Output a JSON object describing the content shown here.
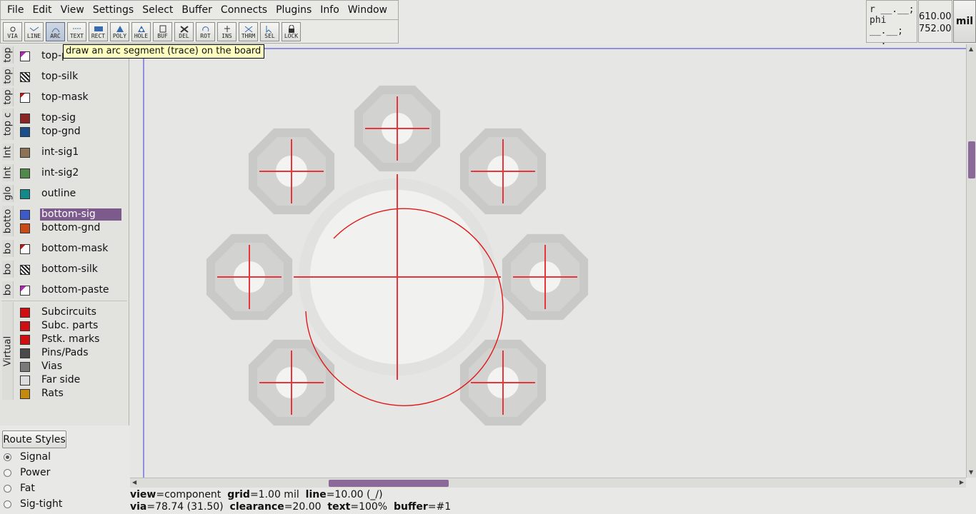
{
  "menu": [
    "File",
    "Edit",
    "View",
    "Settings",
    "Select",
    "Buffer",
    "Connects",
    "Plugins",
    "Info",
    "Window"
  ],
  "toolbar": [
    {
      "label": "VIA",
      "icon": "via-icon"
    },
    {
      "label": "LINE",
      "icon": "line-icon"
    },
    {
      "label": "ARC",
      "icon": "arc-icon",
      "active": true
    },
    {
      "label": "TEXT",
      "icon": "text-icon"
    },
    {
      "label": "RECT",
      "icon": "rect-icon"
    },
    {
      "label": "POLY",
      "icon": "poly-icon"
    },
    {
      "label": "HOLE",
      "icon": "hole-icon"
    },
    {
      "label": "BUF",
      "icon": "buffer-icon"
    },
    {
      "label": "DEL",
      "icon": "delete-icon"
    },
    {
      "label": "ROT",
      "icon": "rotate-icon"
    },
    {
      "label": "INS",
      "icon": "insert-icon"
    },
    {
      "label": "THRM",
      "icon": "thermal-icon"
    },
    {
      "label": "SEL",
      "icon": "select-icon"
    },
    {
      "label": "LOCK",
      "icon": "lock-icon"
    }
  ],
  "tooltip": "draw an arc segment (trace) on the board",
  "coords": {
    "r_label": "r __.__;",
    "phi_label": "phi __.__;",
    "blank": "__.__ __.__",
    "x": "610.00",
    "y": "752.00",
    "unit": "mil"
  },
  "layer_groups": [
    "top",
    "top",
    "top",
    "top c",
    "Int",
    "Int",
    "glo",
    "botto",
    "bo",
    "bo",
    "bo",
    "Virtual"
  ],
  "layers": [
    {
      "name": "top-paste",
      "color": "#ffffff"
    },
    {
      "name": "top-silk",
      "color": "#222222"
    },
    {
      "name": "top-mask",
      "color": "#ffffff"
    },
    {
      "name": "top-sig",
      "color": "#8b2525"
    },
    {
      "name": "top-gnd",
      "color": "#1a4f8c"
    },
    {
      "name": "int-sig1",
      "color": "#8c7355"
    },
    {
      "name": "int-sig2",
      "color": "#4f8a4a"
    },
    {
      "name": "outline",
      "color": "#138a8a"
    },
    {
      "name": "bottom-sig",
      "color": "#3e59c9",
      "selected": true
    },
    {
      "name": "bottom-gnd",
      "color": "#c94a14"
    },
    {
      "name": "bottom-mask",
      "color": "#ffffff"
    },
    {
      "name": "bottom-silk",
      "color": "#222222"
    },
    {
      "name": "bottom-paste",
      "color": "#ffffff"
    }
  ],
  "virtual_layers": [
    {
      "name": "Subcircuits",
      "color": "#d01010"
    },
    {
      "name": "Subc. parts",
      "color": "#d01010"
    },
    {
      "name": "Pstk. marks",
      "color": "#d01010"
    },
    {
      "name": "Pins/Pads",
      "color": "#4a4a4a"
    },
    {
      "name": "Vias",
      "color": "#7a7a7a"
    },
    {
      "name": "Far side",
      "color": "#dddddd"
    },
    {
      "name": "Rats",
      "color": "#c48a10"
    }
  ],
  "route_styles": {
    "button": "Route Styles",
    "items": [
      {
        "name": "Signal",
        "selected": true
      },
      {
        "name": "Power"
      },
      {
        "name": "Fat"
      },
      {
        "name": "Sig-tight"
      }
    ]
  },
  "status": {
    "view_k": "view",
    "view_v": "=component",
    "grid_k": "grid",
    "grid_v": "=1.00 mil",
    "line_k": "line",
    "line_v": "=10.00 (_/)",
    "via_k": "via",
    "via_v": "=78.74 (31.50)",
    "clear_k": "clearance",
    "clear_v": "=20.00",
    "text_k": "text",
    "text_v": "=100%",
    "buffer_k": "buffer",
    "buffer_v": "=#1"
  }
}
